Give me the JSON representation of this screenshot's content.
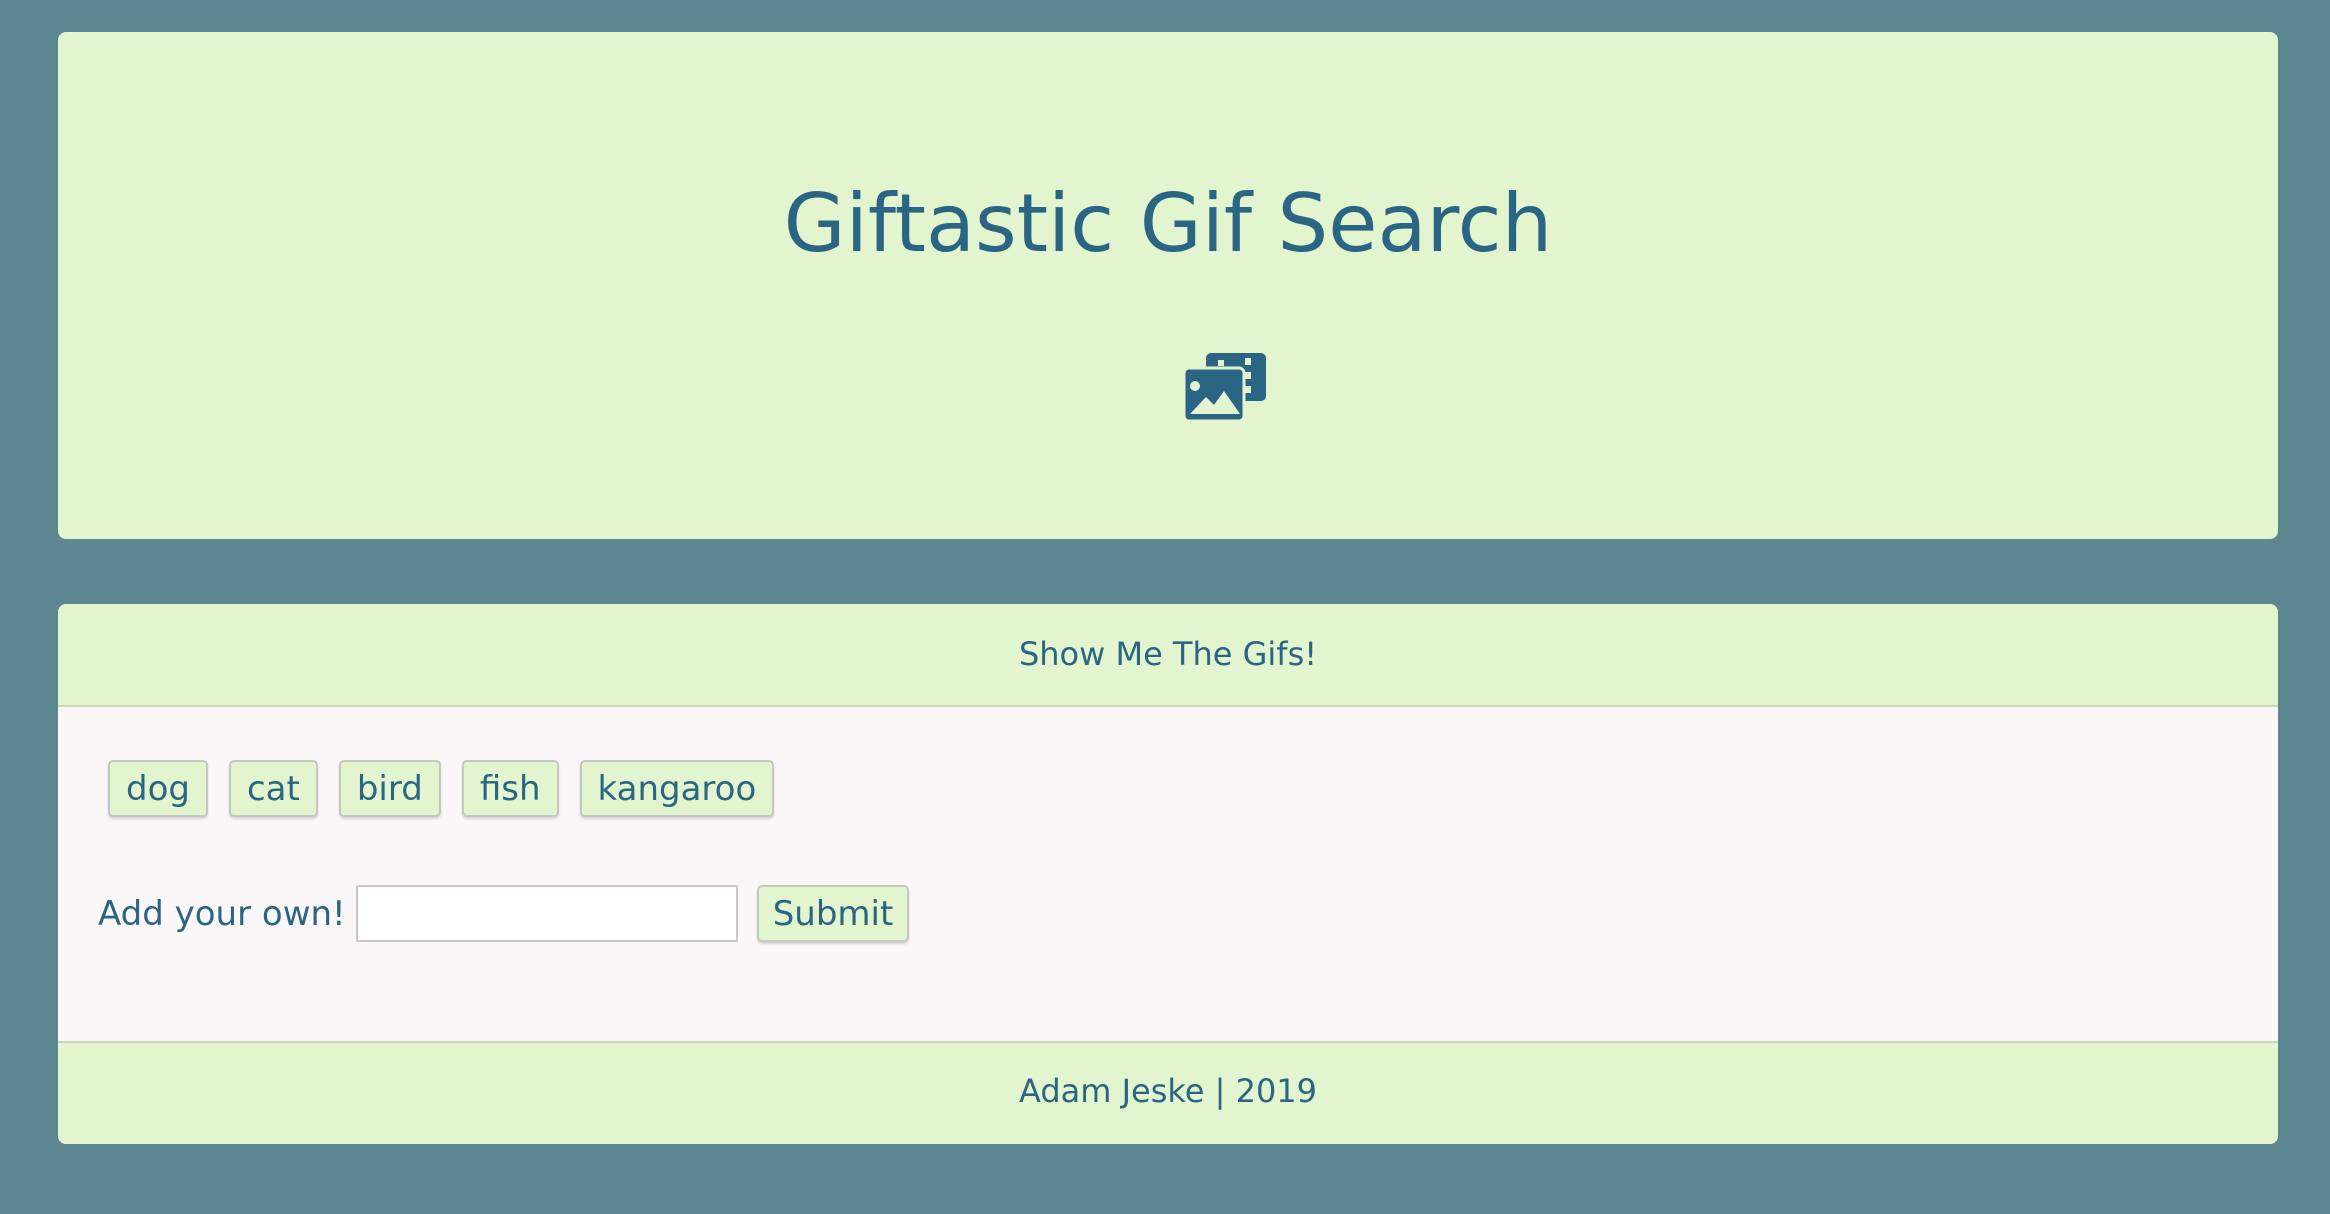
{
  "colors": {
    "page_background": "#5d8790",
    "panel_background": "#e3f5cf",
    "body_background": "#fbf6f7",
    "text": "#2a6683"
  },
  "header": {
    "title": "Giftastic Gif Search",
    "icon": "photo-video-icon"
  },
  "panel": {
    "heading": "Show Me The Gifs!",
    "topics": [
      "dog",
      "cat",
      "bird",
      "fish",
      "kangaroo"
    ],
    "add_label": "Add your own!",
    "input_value": "",
    "input_placeholder": "",
    "submit_label": "Submit",
    "footer": "Adam Jeske | 2019"
  }
}
